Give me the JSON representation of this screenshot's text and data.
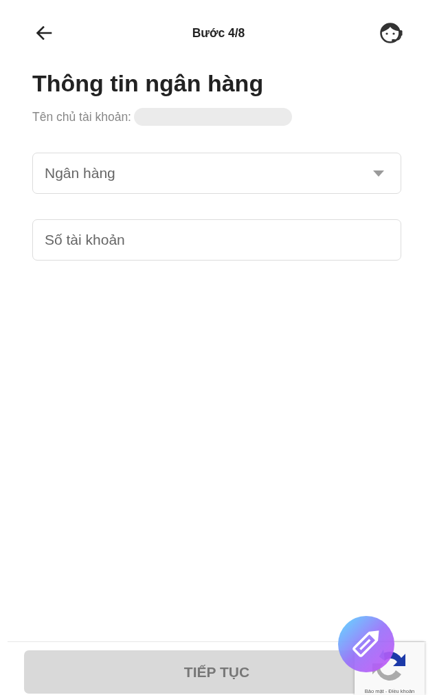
{
  "header": {
    "title": "Bước 4/8"
  },
  "heading": "Thông tin ngân hàng",
  "account_holder": {
    "label": "Tên chủ tài khoản:"
  },
  "fields": [
    {
      "kind": "select",
      "placeholder": "Ngân hàng"
    },
    {
      "kind": "text",
      "placeholder": "Số tài khoản"
    }
  ],
  "continue_button": {
    "label": "TIẾP TỤC",
    "disabled": true
  },
  "recaptcha_badge": {
    "text": "Bảo mật - Điều khoản"
  }
}
